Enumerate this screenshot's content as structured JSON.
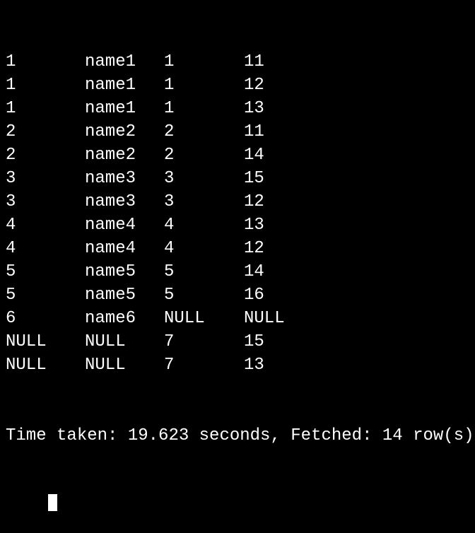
{
  "rows": [
    {
      "c1": "1",
      "c2": "name1",
      "c3": "1",
      "c4": "11"
    },
    {
      "c1": "1",
      "c2": "name1",
      "c3": "1",
      "c4": "12"
    },
    {
      "c1": "1",
      "c2": "name1",
      "c3": "1",
      "c4": "13"
    },
    {
      "c1": "2",
      "c2": "name2",
      "c3": "2",
      "c4": "11"
    },
    {
      "c1": "2",
      "c2": "name2",
      "c3": "2",
      "c4": "14"
    },
    {
      "c1": "3",
      "c2": "name3",
      "c3": "3",
      "c4": "15"
    },
    {
      "c1": "3",
      "c2": "name3",
      "c3": "3",
      "c4": "12"
    },
    {
      "c1": "4",
      "c2": "name4",
      "c3": "4",
      "c4": "13"
    },
    {
      "c1": "4",
      "c2": "name4",
      "c3": "4",
      "c4": "12"
    },
    {
      "c1": "5",
      "c2": "name5",
      "c3": "5",
      "c4": "14"
    },
    {
      "c1": "5",
      "c2": "name5",
      "c3": "5",
      "c4": "16"
    },
    {
      "c1": "6",
      "c2": "name6",
      "c3": "NULL",
      "c4": "NULL"
    },
    {
      "c1": "NULL",
      "c2": "NULL",
      "c3": "7",
      "c4": "15"
    },
    {
      "c1": "NULL",
      "c2": "NULL",
      "c3": "7",
      "c4": "13"
    }
  ],
  "status": "Time taken: 19.623 seconds, Fetched: 14 row(s)"
}
